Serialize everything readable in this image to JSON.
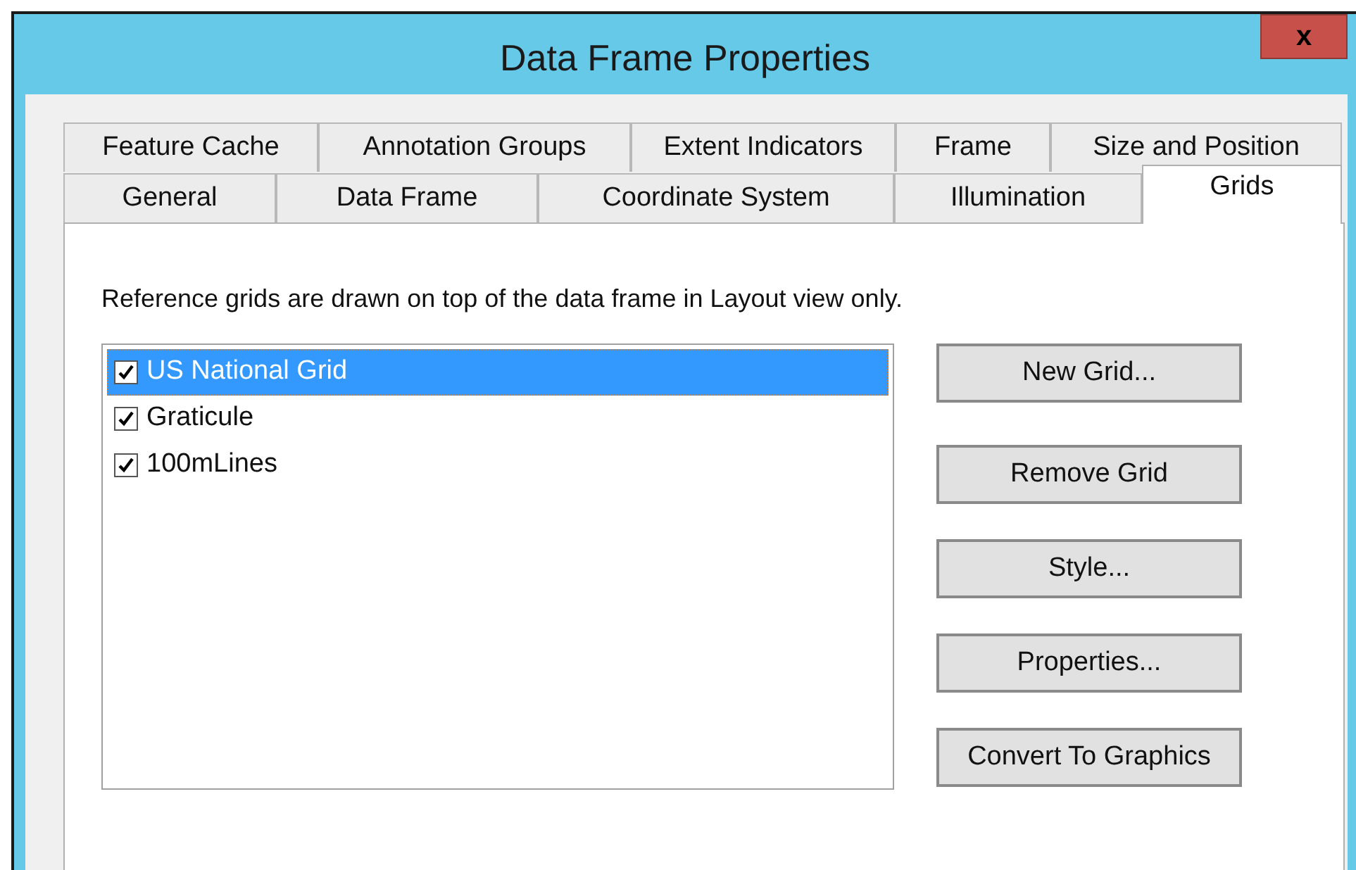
{
  "window": {
    "title": "Data Frame Properties",
    "close": "x"
  },
  "tab_rows": [
    [
      {
        "label": "Feature Cache",
        "selected": false
      },
      {
        "label": "Annotation Groups",
        "selected": false
      },
      {
        "label": "Extent Indicators",
        "selected": false
      },
      {
        "label": "Frame",
        "selected": false
      },
      {
        "label": "Size and Position",
        "selected": false
      }
    ],
    [
      {
        "label": "General",
        "selected": false
      },
      {
        "label": "Data Frame",
        "selected": false
      },
      {
        "label": "Coordinate System",
        "selected": false
      },
      {
        "label": "Illumination",
        "selected": false
      },
      {
        "label": "Grids",
        "selected": true
      }
    ]
  ],
  "description": "Reference grids are drawn on top of the data frame in Layout view only.",
  "grids": [
    {
      "label": "US National Grid",
      "checked": true,
      "selected": true
    },
    {
      "label": "Graticule",
      "checked": true,
      "selected": false
    },
    {
      "label": "100mLines",
      "checked": true,
      "selected": false
    }
  ],
  "buttons": [
    "New Grid...",
    "Remove Grid",
    "Style...",
    "Properties...",
    "Convert To Graphics"
  ]
}
